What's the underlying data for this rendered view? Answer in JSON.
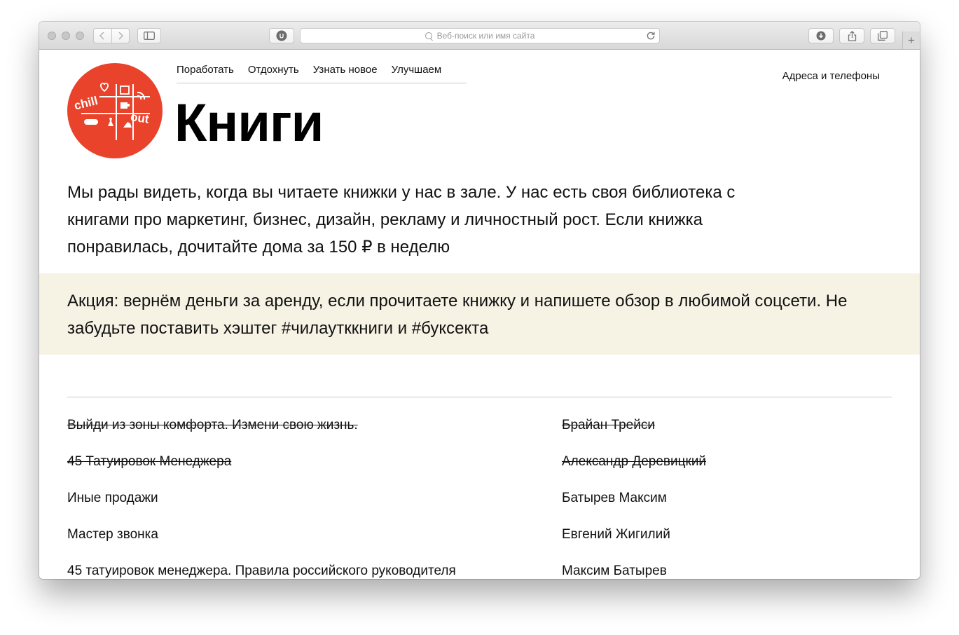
{
  "browser": {
    "address_placeholder": "Веб-поиск или имя сайта",
    "extension_badge": "U"
  },
  "site": {
    "logo_text": [
      "chill",
      "out"
    ],
    "nav": [
      "Поработать",
      "Отдохнуть",
      "Узнать новое",
      "Улучшаем"
    ],
    "contacts_link": "Адреса и телефоны",
    "brand_color": "#e9432c"
  },
  "page": {
    "title": "Книги",
    "intro": "Мы рады видеть, когда вы читаете книжки у нас в зале. У нас есть своя библиотека с книгами про маркетинг, бизнес, дизайн, рекламу и личностный рост. Если книжка понравилась, дочитайте дома за 150 ₽ в неделю",
    "promo": "Акция: вернём деньги за аренду, если прочитаете книжку и напишете обзор в любимой соцсети. Не забудьте поставить хэштег #чилаутккниги и #буксекта",
    "promo_bg": "#f6f3e5"
  },
  "books": [
    {
      "title": "Выйди из зоны комфорта. Измени свою жизнь.",
      "author": "Брайан Трейси",
      "taken": true
    },
    {
      "title": "45 Татуировок Менеджера",
      "author": "Александр Деревицкий",
      "taken": true
    },
    {
      "title": "Иные продажи",
      "author": "Батырев Максим",
      "taken": false
    },
    {
      "title": "Мастер звонка",
      "author": "Евгений Жигилий",
      "taken": false
    },
    {
      "title": "45 татуировок менеджера. Правила российского руководителя",
      "author": "Максим Батырев",
      "taken": false
    }
  ]
}
